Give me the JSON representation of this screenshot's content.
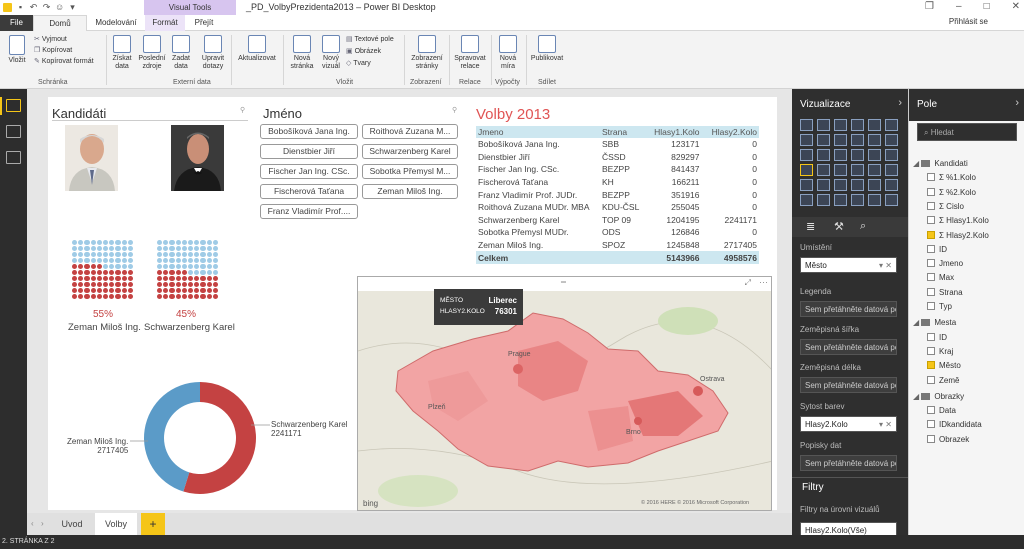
{
  "app": {
    "title": "_PD_VolbyPrezidenta2013 – Power BI Desktop",
    "context_tab_group": "Visual Tools",
    "sign_in": "Přihlásit se"
  },
  "tabs": [
    "File",
    "Domů",
    "Modelování",
    "Formát",
    "Přejít"
  ],
  "ribbon": {
    "paste": "Vložit",
    "cut": "Vyjmout",
    "copy": "Kopírovat",
    "copy_format": "Kopírovat formát",
    "group_clipboard": "Schránka",
    "get_data": "Získat data",
    "recent_sources": "Poslední zdroje",
    "enter_data": "Zadat data",
    "edit_queries": "Upravit dotazy",
    "group_external": "Externí data",
    "refresh": "Aktualizovat",
    "new_page": "Nová stránka",
    "new_visual": "Nový vizuál",
    "textbox": "Textové pole",
    "image": "Obrázek",
    "shapes": "Tvary",
    "group_insert": "Vložit",
    "page_view": "Zobrazení stránky",
    "group_view": "Zobrazení",
    "manage_rel": "Spravovat relace",
    "group_rel": "Relace",
    "new_measure": "Nová míra",
    "group_calc": "Výpočty",
    "publish": "Publikovat",
    "group_share": "Sdílet"
  },
  "report": {
    "kandidati_title": "Kandidáti",
    "jmeno_title": "Jméno",
    "volby_title": "Volby 2013",
    "slicer_items": [
      "Bobošíková Jana Ing.",
      "Roithová Zuzana M...",
      "Dienstbier Jiří",
      "Schwarzenberg Karel",
      "Fischer Jan Ing. CSc.",
      "Sobotka Přemysl M...",
      "Fischerová Taťana",
      "Zeman Miloš Ing.",
      "Franz Vladimír Prof...."
    ],
    "waffle1": {
      "pct_label": "55%",
      "name": "Zeman Miloš Ing.",
      "fraction": 0.55
    },
    "waffle2": {
      "pct_label": "45%",
      "name": "Schwarzenberg Karel",
      "fraction": 0.45
    },
    "donut": {
      "label_left_name": "Zeman Miloš Ing.",
      "label_left_value": "2717405",
      "label_right_name": "Schwarzenberg Karel",
      "label_right_value": "2241171",
      "values": [
        2717405,
        2241171
      ]
    },
    "table": {
      "headers": [
        "Jmeno",
        "Strana",
        "Hlasy1.Kolo",
        "Hlasy2.Kolo"
      ],
      "rows": [
        [
          "Bobošíková Jana Ing.",
          "SBB",
          "123171",
          "0"
        ],
        [
          "Dienstbier Jiří",
          "ČSSD",
          "829297",
          "0"
        ],
        [
          "Fischer Jan Ing. CSc.",
          "BEZPP",
          "841437",
          "0"
        ],
        [
          "Fischerová Taťana",
          "KH",
          "166211",
          "0"
        ],
        [
          "Franz Vladimír Prof. JUDr.",
          "BEZPP",
          "351916",
          "0"
        ],
        [
          "Roithová Zuzana MUDr. MBA",
          "KDU-ČSL",
          "255045",
          "0"
        ],
        [
          "Schwarzenberg Karel",
          "TOP 09",
          "1204195",
          "2241171"
        ],
        [
          "Sobotka Přemysl MUDr.",
          "ODS",
          "126846",
          "0"
        ],
        [
          "Zeman Miloš Ing.",
          "SPOZ",
          "1245848",
          "2717405"
        ]
      ],
      "total": [
        "Celkem",
        "",
        "5143966",
        "4958576"
      ]
    },
    "map": {
      "tooltip_key1": "MĚSTO",
      "tooltip_val1": "Liberec",
      "tooltip_key2": "HLASY2.KOLO",
      "tooltip_val2": "76301",
      "bing": "bing",
      "copyright": "© 2016 HERE   © 2016 Microsoft Corporation",
      "city_labels": [
        "Prague",
        "Brno",
        "Plzeň",
        "Ostrava"
      ]
    }
  },
  "viz_pane": {
    "title": "Vizualizace",
    "location": "Umístění",
    "location_value": "Město",
    "legend": "Legenda",
    "drop_hint": "Sem přetáhněte datová pole.",
    "lat": "Zeměpisná šířka",
    "lon": "Zeměpisná délka",
    "color_sat": "Sytost barev",
    "color_sat_value": "Hlasy2.Kolo",
    "tooltips": "Popisky dat",
    "filters": "Filtry",
    "filters_visual": "Filtry na úrovni vizuálů",
    "filter_value": "Hlasy2.Kolo(Vše)"
  },
  "field_pane": {
    "title": "Pole",
    "search_placeholder": "Hledat",
    "tables": [
      {
        "name": "Kandidati",
        "fields": [
          {
            "name": "%1.Kolo",
            "checked": false,
            "sigma": true
          },
          {
            "name": "%2.Kolo",
            "checked": false,
            "sigma": true
          },
          {
            "name": "Cislo",
            "checked": false,
            "sigma": true
          },
          {
            "name": "Hlasy1.Kolo",
            "checked": false,
            "sigma": true
          },
          {
            "name": "Hlasy2.Kolo",
            "checked": true,
            "sigma": true
          },
          {
            "name": "ID",
            "checked": false,
            "sigma": false
          },
          {
            "name": "Jmeno",
            "checked": false,
            "sigma": false
          },
          {
            "name": "Max",
            "checked": false,
            "sigma": false
          },
          {
            "name": "Strana",
            "checked": false,
            "sigma": false
          },
          {
            "name": "Typ",
            "checked": false,
            "sigma": false
          }
        ]
      },
      {
        "name": "Mesta",
        "fields": [
          {
            "name": "ID",
            "checked": false,
            "sigma": false
          },
          {
            "name": "Kraj",
            "checked": false,
            "sigma": false
          },
          {
            "name": "Město",
            "checked": true,
            "sigma": false
          },
          {
            "name": "Země",
            "checked": false,
            "sigma": false
          }
        ]
      },
      {
        "name": "Obrazky",
        "fields": [
          {
            "name": "Data",
            "checked": false,
            "sigma": false
          },
          {
            "name": "IDkandidata",
            "checked": false,
            "sigma": false
          },
          {
            "name": "Obrazek",
            "checked": false,
            "sigma": false
          }
        ]
      }
    ]
  },
  "pages": {
    "tab1": "Uvod",
    "tab2": "Volby",
    "add": "+"
  },
  "status": "2. STRÁNKA Z 2",
  "colors": {
    "accent": "#f5c518",
    "red": "#c44242",
    "lightblue": "#9fcbe6",
    "table_header": "#cde7f0"
  }
}
